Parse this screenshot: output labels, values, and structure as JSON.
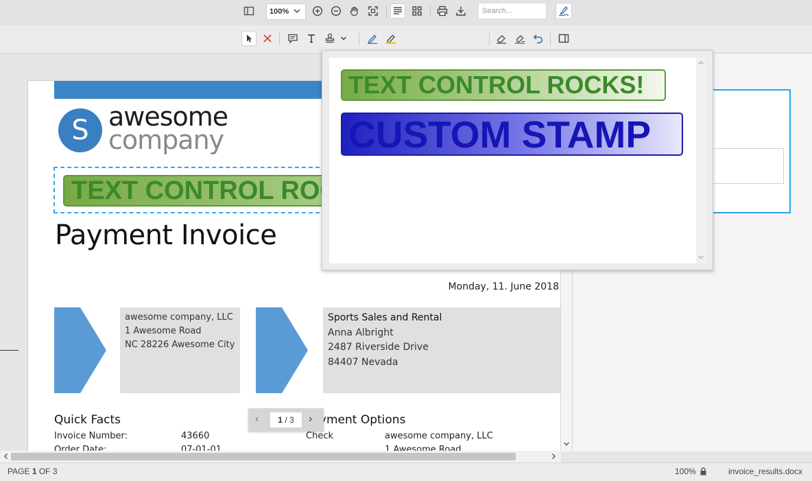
{
  "toolbar": {
    "zoom_value": "100%",
    "search_placeholder": "Search...",
    "font_button_label": "Aa"
  },
  "stamps_popup": {
    "stamps": [
      {
        "label": "TEXT CONTROL ROCKS!"
      },
      {
        "label": "CUSTOM STAMP"
      }
    ]
  },
  "document": {
    "logo": {
      "initial": "S",
      "line1": "awesome",
      "line2": "company"
    },
    "placed_stamp": "TEXT CONTROL ROCKS!",
    "title": "Payment Invoice",
    "date": "Monday, 11. June 2018",
    "sender": {
      "lines": [
        "awesome company, LLC",
        "1 Awesome Road",
        "NC 28226 Awesome City"
      ]
    },
    "recipient": {
      "lines": [
        "Sports Sales and Rental",
        "Anna Albright",
        "2487 Riverside Drive",
        "84407 Nevada"
      ]
    },
    "quick_facts": {
      "title": "Quick Facts",
      "rows": [
        {
          "label": "Invoice Number:",
          "value": "43660"
        },
        {
          "label": "Order Date:",
          "value": "07-01-01"
        }
      ]
    },
    "payment_options": {
      "title": "Payment Options",
      "rows": [
        {
          "label": "Check",
          "value": "awesome company, LLC"
        },
        {
          "label": "",
          "value": "1 Awesome Road"
        }
      ]
    }
  },
  "pager": {
    "current": "1",
    "total": "3"
  },
  "status": {
    "page_prefix": "PAGE",
    "page_current": "1",
    "page_of": "OF",
    "page_total": "3",
    "zoom": "100%",
    "filename": "invoice_results.docx"
  },
  "colors": {
    "accent": "#3a85c6",
    "stamp_green": "#3a8a2a",
    "stamp_blue": "#1616b6",
    "selection": "#2aa4e3"
  }
}
